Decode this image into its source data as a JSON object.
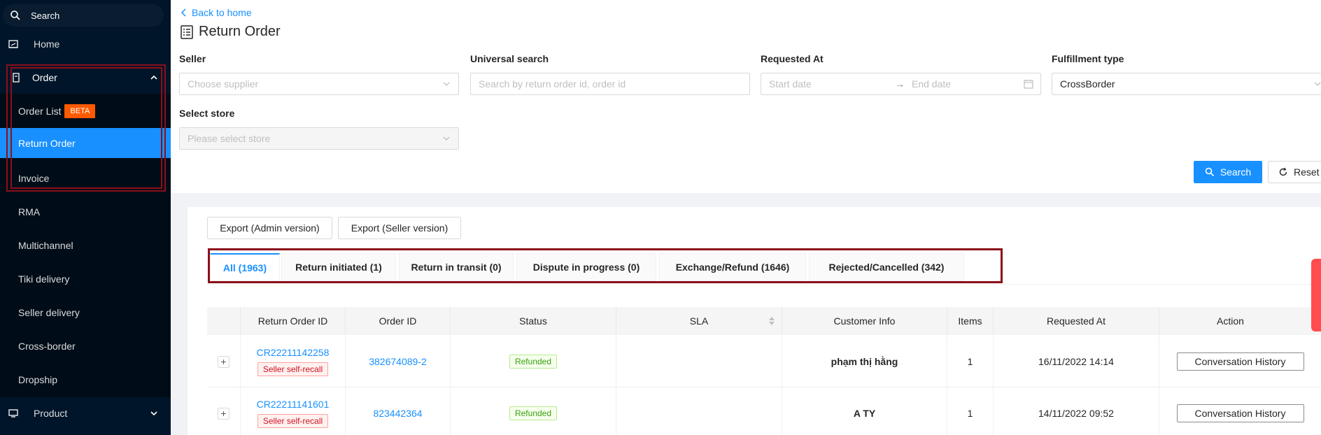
{
  "sidebar": {
    "search_label": "Search",
    "items": {
      "home": "Home",
      "order": "Order",
      "order_list": "Order List",
      "order_list_badge": "BETA",
      "return_order": "Return Order",
      "invoice": "Invoice",
      "rma": "RMA",
      "multichannel": "Multichannel",
      "tiki_delivery": "Tiki delivery",
      "seller_delivery": "Seller delivery",
      "cross_border": "Cross-border",
      "dropship": "Dropship",
      "product": "Product"
    }
  },
  "header": {
    "back_label": "Back to home",
    "title": "Return Order"
  },
  "filters": {
    "seller_label": "Seller",
    "seller_placeholder": "Choose supplier",
    "universal_label": "Universal search",
    "universal_placeholder": "Search by return order id, order id",
    "requested_label": "Requested At",
    "start_placeholder": "Start date",
    "end_placeholder": "End date",
    "fulfillment_label": "Fulfillment type",
    "fulfillment_value": "CrossBorder",
    "store_label": "Select store",
    "store_placeholder": "Please select store",
    "search_button": "Search",
    "reset_button": "Reset"
  },
  "exports": {
    "admin": "Export (Admin version)",
    "seller": "Export (Seller version)"
  },
  "tabs": [
    {
      "label": "All (1963)",
      "active": true
    },
    {
      "label": "Return initiated (1)"
    },
    {
      "label": "Return in transit (0)"
    },
    {
      "label": "Dispute in progress (0)"
    },
    {
      "label": "Exchange/Refund (1646)"
    },
    {
      "label": "Rejected/Cancelled (342)"
    }
  ],
  "table": {
    "columns": [
      "",
      "Return Order ID",
      "Order ID",
      "Status",
      "SLA",
      "Customer Info",
      "Items",
      "Requested At",
      "Action"
    ],
    "rows": [
      {
        "expand": "+",
        "return_order_id": "CR22211142258",
        "tag": "Seller self-recall",
        "order_id": "382674089-2",
        "status": "Refunded",
        "sla": "",
        "customer": "phạm thị hằng",
        "items": "1",
        "requested_at": "16/11/2022 14:14",
        "action": "Conversation History"
      },
      {
        "expand": "+",
        "return_order_id": "CR22211141601",
        "tag": "Seller self-recall",
        "order_id": "823442364",
        "status": "Refunded",
        "sla": "",
        "customer": "A TY",
        "items": "1",
        "requested_at": "14/11/2022 09:52",
        "action": "Conversation History"
      }
    ]
  },
  "colors": {
    "sidebar_bg": "#001529",
    "primary": "#1890ff",
    "highlight_border": "#8b0f1a",
    "beta_badge": "#ff5a00"
  }
}
